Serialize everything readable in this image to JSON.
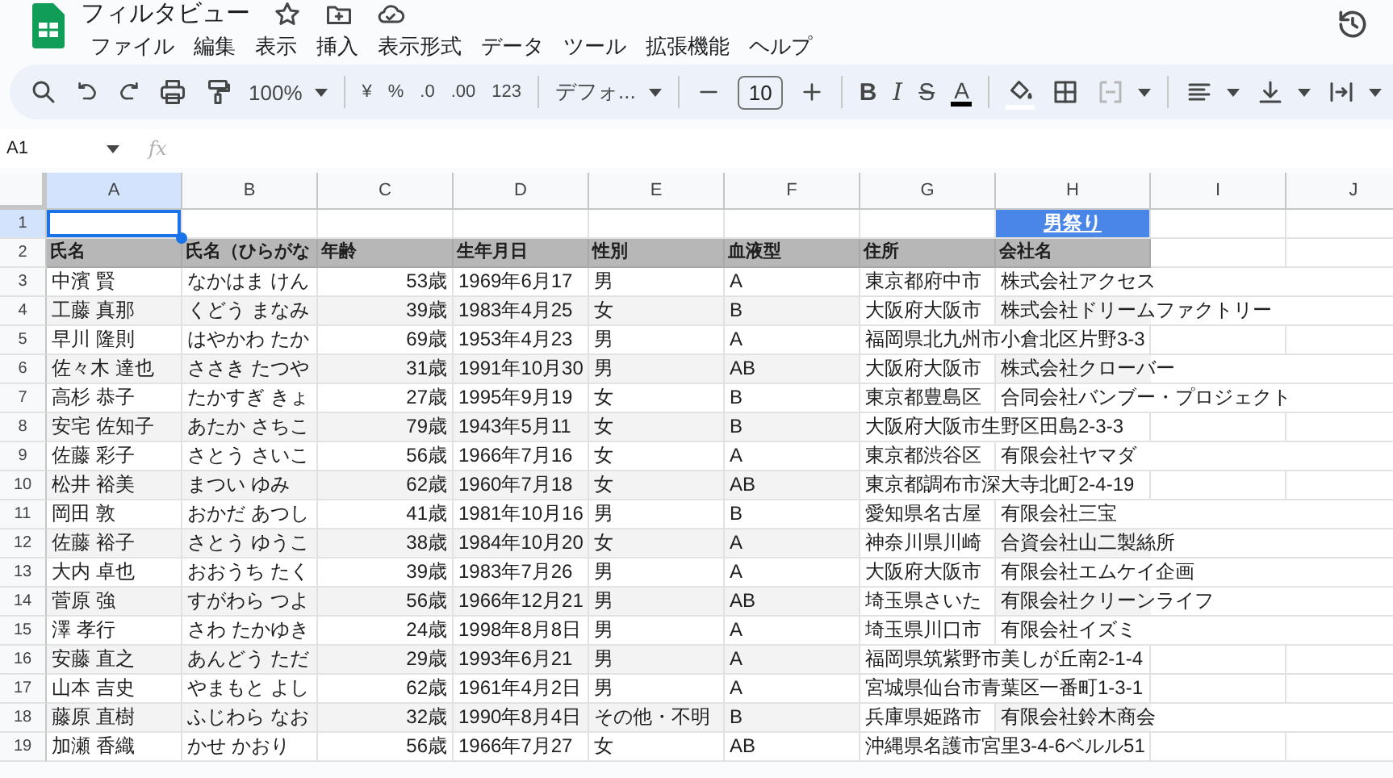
{
  "app": {
    "title": "フィルタビュー",
    "menu": [
      "ファイル",
      "編集",
      "表示",
      "挿入",
      "表示形式",
      "データ",
      "ツール",
      "拡張機能",
      "ヘルプ"
    ]
  },
  "toolbar": {
    "zoom": "100%",
    "currency": "¥",
    "percent": "%",
    "decimal_decrease": ".0",
    "decimal_increase": ".00",
    "number_format": "123",
    "font": "デフォ...",
    "font_size": "10",
    "bold": "B",
    "italic": "I",
    "strikethrough": "S",
    "text_color": "A"
  },
  "formula_bar": {
    "cell_ref": "A1",
    "fx": "fx"
  },
  "sheet": {
    "columns": [
      {
        "label": "A",
        "selected": true
      },
      {
        "label": "B",
        "selected": false
      },
      {
        "label": "C",
        "selected": false
      },
      {
        "label": "D",
        "selected": false
      },
      {
        "label": "E",
        "selected": false
      },
      {
        "label": "F",
        "selected": false
      },
      {
        "label": "G",
        "selected": false
      },
      {
        "label": "H",
        "selected": false
      },
      {
        "label": "I",
        "selected": false
      },
      {
        "label": "J",
        "selected": false
      }
    ],
    "title_row": {
      "number": "1",
      "selected": true,
      "link": "男祭り"
    },
    "header_row": {
      "number": "2",
      "cells": [
        "氏名",
        "氏名（ひらがな",
        "年齢",
        "生年月日",
        "性別",
        "血液型",
        "住所",
        "会社名"
      ]
    },
    "data_rows": [
      {
        "number": "3",
        "cells": [
          "中濱 賢",
          "なかはま けん",
          "53歳",
          "1969年6月17",
          "男",
          "A",
          "東京都府中市",
          "株式会社アクセス"
        ]
      },
      {
        "number": "4",
        "cells": [
          "工藤 真那",
          "くどう まなみ",
          "39歳",
          "1983年4月25",
          "女",
          "B",
          "大阪府大阪市",
          "株式会社ドリームファクトリー"
        ]
      },
      {
        "number": "5",
        "cells": [
          "早川 隆則",
          "はやかわ たか",
          "69歳",
          "1953年4月23",
          "男",
          "A",
          "福岡県北九州市小倉北区片野3-3"
        ]
      },
      {
        "number": "6",
        "cells": [
          "佐々木 達也",
          "ささき たつや",
          "31歳",
          "1991年10月30",
          "男",
          "AB",
          "大阪府大阪市",
          "株式会社クローバー"
        ]
      },
      {
        "number": "7",
        "cells": [
          "高杉 恭子",
          "たかすぎ きょ",
          "27歳",
          "1995年9月19",
          "女",
          "B",
          "東京都豊島区",
          "合同会社バンブー・プロジェクト"
        ]
      },
      {
        "number": "8",
        "cells": [
          "安宅 佐知子",
          "あたか さちこ",
          "79歳",
          "1943年5月11",
          "女",
          "B",
          "大阪府大阪市生野区田島2-3-3"
        ]
      },
      {
        "number": "9",
        "cells": [
          "佐藤 彩子",
          "さとう さいこ",
          "56歳",
          "1966年7月16",
          "女",
          "A",
          "東京都渋谷区",
          "有限会社ヤマダ"
        ]
      },
      {
        "number": "10",
        "cells": [
          "松井 裕美",
          "まつい ゆみ",
          "62歳",
          "1960年7月18",
          "女",
          "AB",
          "東京都調布市深大寺北町2-4-19"
        ]
      },
      {
        "number": "11",
        "cells": [
          "岡田 敦",
          "おかだ あつし",
          "41歳",
          "1981年10月16",
          "男",
          "B",
          "愛知県名古屋",
          "有限会社三宝"
        ]
      },
      {
        "number": "12",
        "cells": [
          "佐藤 裕子",
          "さとう ゆうこ",
          "38歳",
          "1984年10月20",
          "女",
          "A",
          "神奈川県川崎",
          "合資会社山二製絲所"
        ]
      },
      {
        "number": "13",
        "cells": [
          "大内 卓也",
          "おおうち たく",
          "39歳",
          "1983年7月26",
          "男",
          "A",
          "大阪府大阪市",
          "有限会社エムケイ企画"
        ]
      },
      {
        "number": "14",
        "cells": [
          "菅原 強",
          "すがわら つよ",
          "56歳",
          "1966年12月21",
          "男",
          "AB",
          "埼玉県さいた",
          "有限会社クリーンライフ"
        ]
      },
      {
        "number": "15",
        "cells": [
          "澤 孝行",
          "さわ たかゆき",
          "24歳",
          "1998年8月8日",
          "男",
          "A",
          "埼玉県川口市",
          "有限会社イズミ"
        ]
      },
      {
        "number": "16",
        "cells": [
          "安藤 直之",
          "あんどう ただ",
          "29歳",
          "1993年6月21",
          "男",
          "A",
          "福岡県筑紫野市美しが丘南2-1-4"
        ]
      },
      {
        "number": "17",
        "cells": [
          "山本 吉史",
          "やまもと よし",
          "62歳",
          "1961年4月2日",
          "男",
          "A",
          "宮城県仙台市青葉区一番町1-3-1"
        ]
      },
      {
        "number": "18",
        "cells": [
          "藤原 直樹",
          "ふじわら なお",
          "32歳",
          "1990年8月4日",
          "その他・不明",
          "B",
          "兵庫県姫路市",
          "有限会社鈴木商会"
        ]
      },
      {
        "number": "19",
        "cells": [
          "加瀬 香織",
          "かせ かおり",
          "56歳",
          "1966年7月27",
          "女",
          "AB",
          "沖縄県名護市宮里3-4-6ベルル51"
        ]
      }
    ]
  }
}
